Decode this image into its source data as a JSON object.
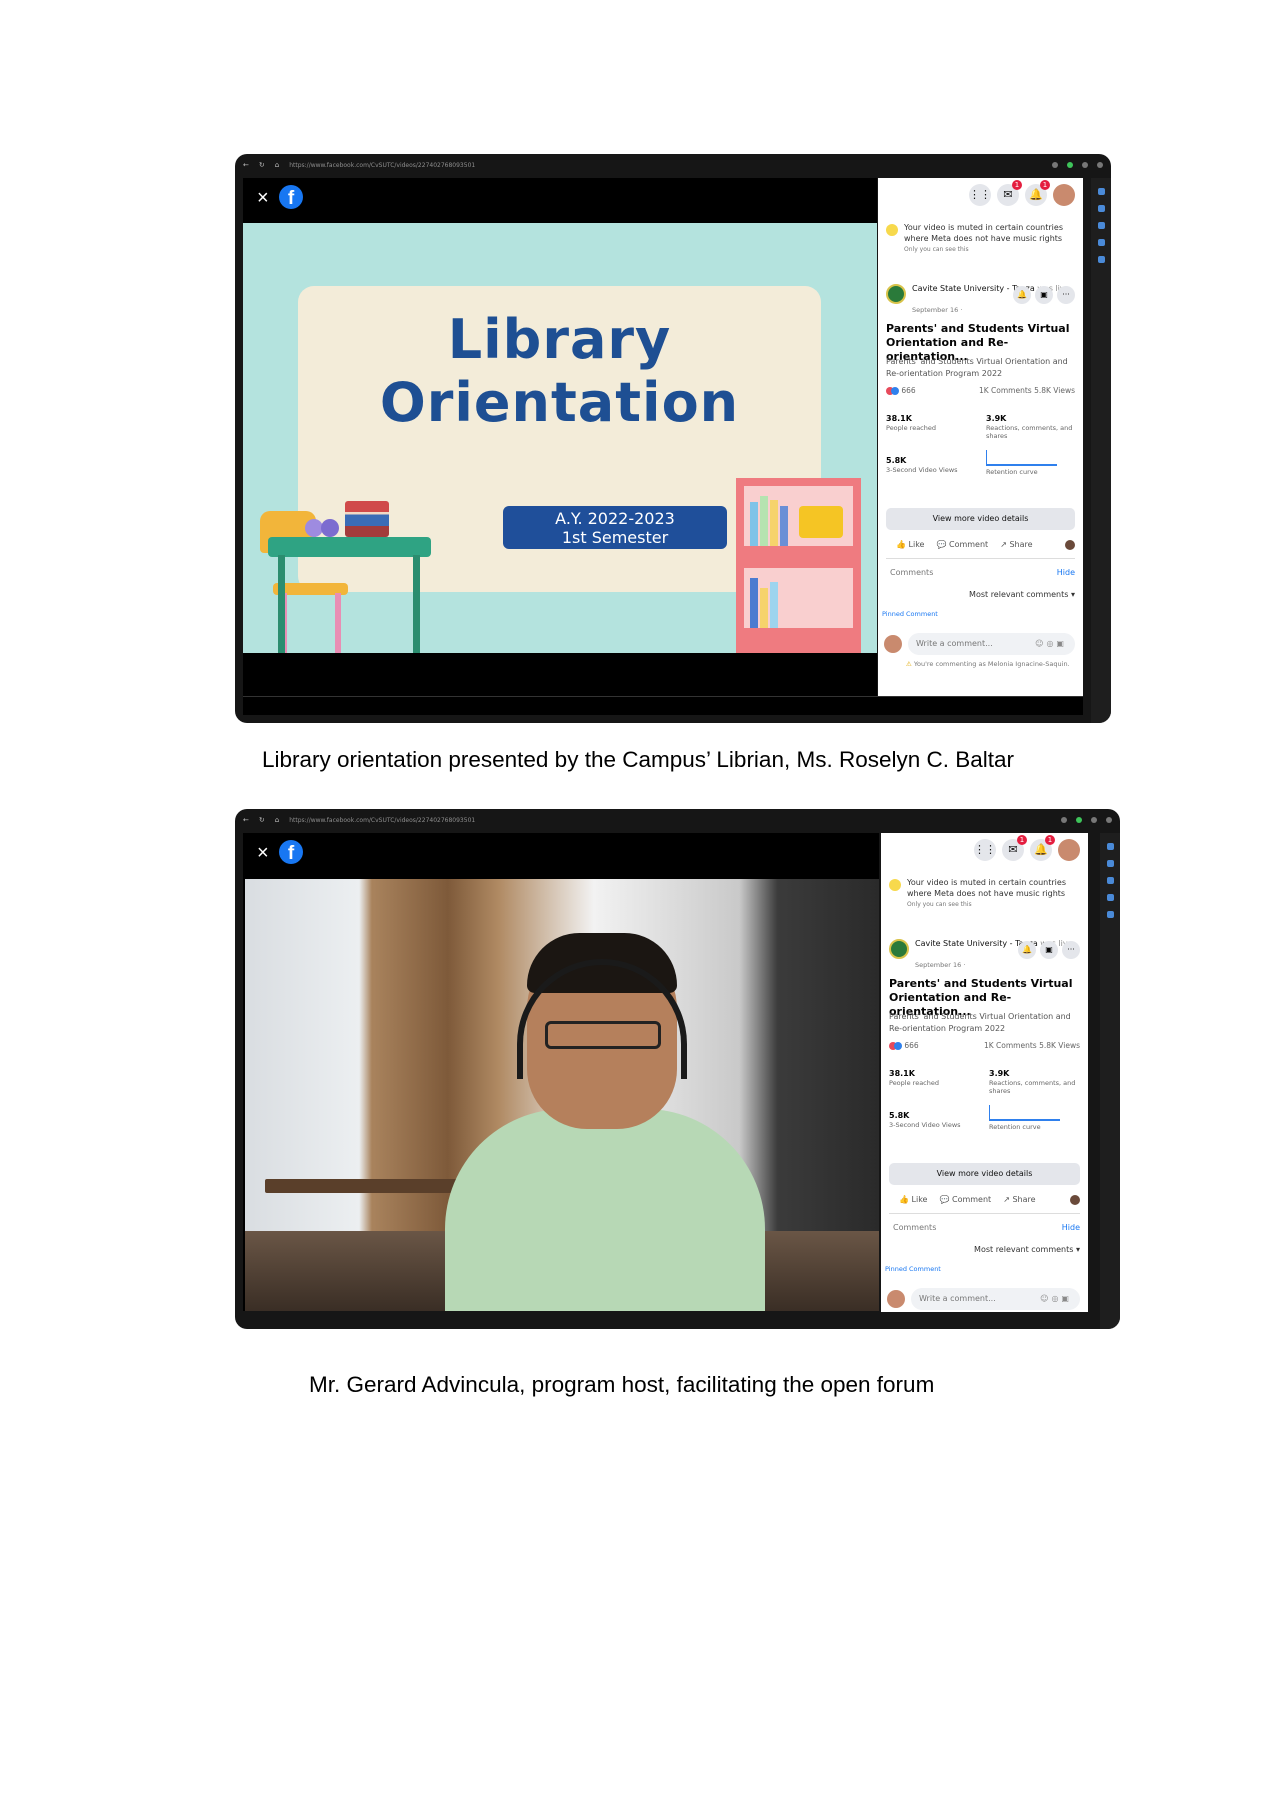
{
  "screenshot1": {
    "url": "https://www.facebook.com/CvSUTC/videos/227402768093501",
    "url_domain": "www.facebook.com",
    "slide": {
      "title_line1": "Library",
      "title_line2": "Orientation",
      "badge_line1": "A.Y. 2022-2023",
      "badge_line2": "1st Semester"
    },
    "caption": "Library orientation presented by the Campus’ Librian, Ms. Roselyn C. Baltar"
  },
  "screenshot2": {
    "caption": "Mr. Gerard Advincula, program host, facilitating the open forum"
  },
  "panel": {
    "notice": "Your video is muted in certain countries where Meta does not have music rights",
    "notice_sub": "Only you can see this",
    "page_name": "Cavite State University - Tanza",
    "page_status": "was live.",
    "page_date": "September 16 ·",
    "video_title": "Parents' and Students Virtual Orientation and Re-orientation...",
    "video_desc": "Parents' and Students Virtual Orientation and Re-orientation Program 2022",
    "reactions": "666",
    "comments_views": "1K Comments  5.8K Views",
    "metrics": [
      {
        "value": "38.1K",
        "label": "People reached"
      },
      {
        "value": "3.9K",
        "label": "Reactions, comments, and shares"
      },
      {
        "value": "5.8K",
        "label": "3-Second Video Views"
      },
      {
        "value": "",
        "label": "Retention curve"
      }
    ],
    "view_more": "View more video details",
    "like": "Like",
    "comment": "Comment",
    "share": "Share",
    "comments_header": "Comments",
    "hide": "Hide",
    "most_relevant": "Most relevant comments ▾",
    "pinned": "Pinned Comment",
    "write_placeholder": "Write a comment...",
    "commenting_as": "You're commenting as Melonia Ignacine-Saquin."
  },
  "badges": {
    "messenger": "1",
    "notifications": "1"
  },
  "colors": {
    "facebook_blue": "#1877f2",
    "slide_bg": "#b4e3de",
    "title_blue": "#1e4f93"
  }
}
